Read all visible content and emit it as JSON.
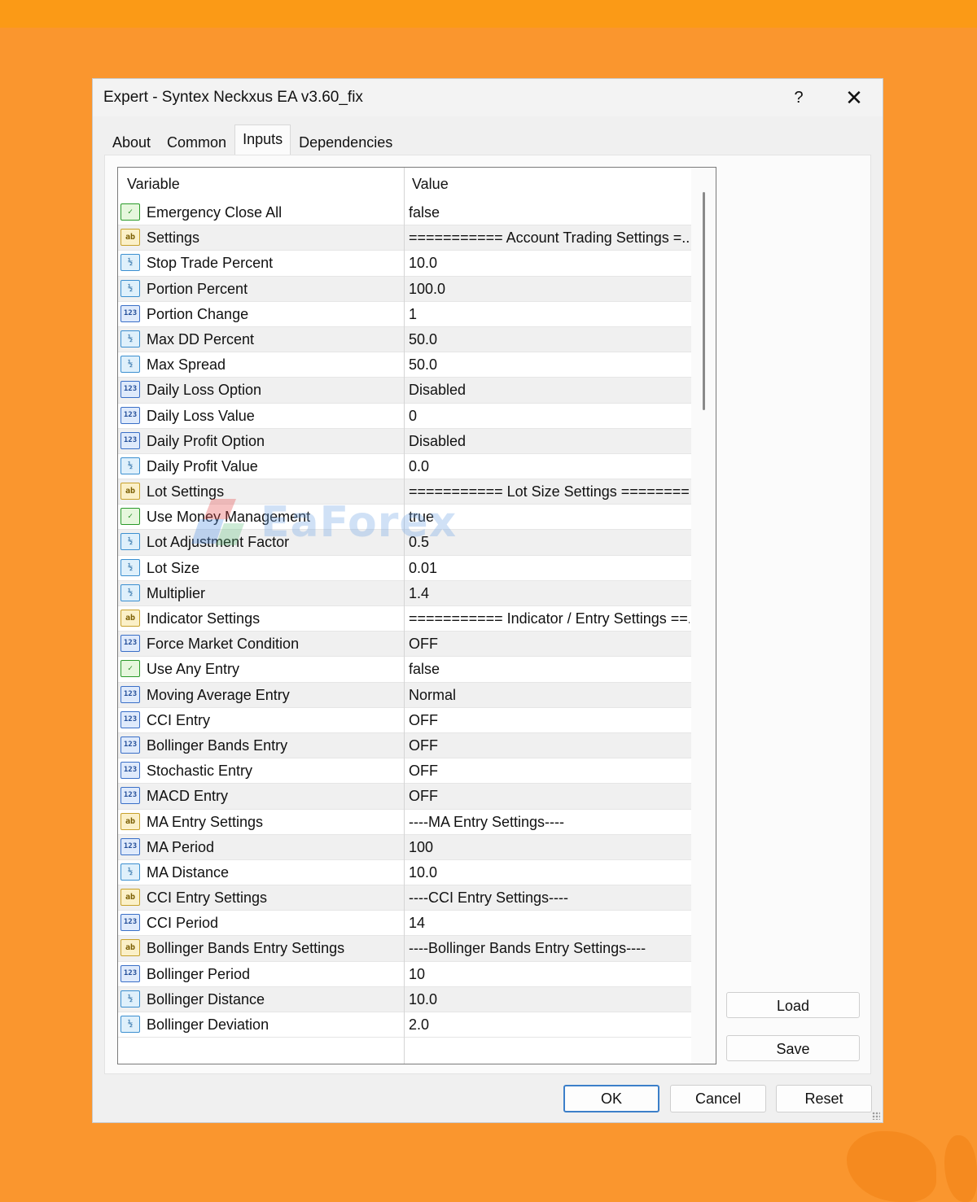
{
  "window": {
    "title": "Expert - Syntex Neckxus EA v3.60_fix",
    "help_glyph": "?",
    "close_glyph": "✕"
  },
  "tabs": [
    {
      "label": "About",
      "active": false
    },
    {
      "label": "Common",
      "active": false
    },
    {
      "label": "Inputs",
      "active": true
    },
    {
      "label": "Dependencies",
      "active": false
    }
  ],
  "grid": {
    "header": {
      "variable": "Variable",
      "value": "Value"
    },
    "rows": [
      {
        "type": "bool",
        "icon": "boolean-icon",
        "name": "Emergency Close All",
        "value": "false"
      },
      {
        "type": "str",
        "icon": "string-icon",
        "name": "Settings",
        "value": "=========== Account Trading Settings =..."
      },
      {
        "type": "dbl",
        "icon": "double-icon",
        "name": "Stop Trade Percent",
        "value": "10.0"
      },
      {
        "type": "dbl",
        "icon": "double-icon",
        "name": "Portion Percent",
        "value": "100.0"
      },
      {
        "type": "int",
        "icon": "integer-icon",
        "name": "Portion Change",
        "value": "1"
      },
      {
        "type": "dbl",
        "icon": "double-icon",
        "name": "Max DD Percent",
        "value": "50.0"
      },
      {
        "type": "dbl",
        "icon": "double-icon",
        "name": "Max Spread",
        "value": "50.0"
      },
      {
        "type": "int",
        "icon": "integer-icon",
        "name": "Daily Loss Option",
        "value": "Disabled"
      },
      {
        "type": "int",
        "icon": "integer-icon",
        "name": "Daily Loss Value",
        "value": "0"
      },
      {
        "type": "int",
        "icon": "integer-icon",
        "name": "Daily Profit Option",
        "value": "Disabled"
      },
      {
        "type": "dbl",
        "icon": "double-icon",
        "name": "Daily Profit Value",
        "value": "0.0"
      },
      {
        "type": "str",
        "icon": "string-icon",
        "name": "Lot Settings",
        "value": "=========== Lot Size Settings ========..."
      },
      {
        "type": "bool",
        "icon": "boolean-icon",
        "name": "Use Money Management",
        "value": "true"
      },
      {
        "type": "dbl",
        "icon": "double-icon",
        "name": "Lot Adjustment Factor",
        "value": "0.5"
      },
      {
        "type": "dbl",
        "icon": "double-icon",
        "name": "Lot Size",
        "value": "0.01"
      },
      {
        "type": "dbl",
        "icon": "double-icon",
        "name": "Multiplier",
        "value": "1.4"
      },
      {
        "type": "str",
        "icon": "string-icon",
        "name": "Indicator Settings",
        "value": "=========== Indicator / Entry Settings ==..."
      },
      {
        "type": "int",
        "icon": "integer-icon",
        "name": "Force Market Condition",
        "value": "OFF"
      },
      {
        "type": "bool",
        "icon": "boolean-icon",
        "name": "Use Any Entry",
        "value": "false"
      },
      {
        "type": "int",
        "icon": "integer-icon",
        "name": "Moving Average Entry",
        "value": "Normal"
      },
      {
        "type": "int",
        "icon": "integer-icon",
        "name": "CCI Entry",
        "value": "OFF"
      },
      {
        "type": "int",
        "icon": "integer-icon",
        "name": "Bollinger Bands Entry",
        "value": "OFF"
      },
      {
        "type": "int",
        "icon": "integer-icon",
        "name": "Stochastic Entry",
        "value": "OFF"
      },
      {
        "type": "int",
        "icon": "integer-icon",
        "name": "MACD Entry",
        "value": "OFF"
      },
      {
        "type": "str",
        "icon": "string-icon",
        "name": "MA Entry Settings",
        "value": "----MA Entry Settings----"
      },
      {
        "type": "int",
        "icon": "integer-icon",
        "name": "MA Period",
        "value": "100"
      },
      {
        "type": "dbl",
        "icon": "double-icon",
        "name": "MA Distance",
        "value": "10.0"
      },
      {
        "type": "str",
        "icon": "string-icon",
        "name": "CCI Entry Settings",
        "value": "----CCI Entry Settings----"
      },
      {
        "type": "int",
        "icon": "integer-icon",
        "name": "CCI Period",
        "value": "14"
      },
      {
        "type": "str",
        "icon": "string-icon",
        "name": "Bollinger Bands Entry Settings",
        "value": "----Bollinger Bands Entry Settings----"
      },
      {
        "type": "int",
        "icon": "integer-icon",
        "name": "Bollinger Period",
        "value": "10"
      },
      {
        "type": "dbl",
        "icon": "double-icon",
        "name": "Bollinger Distance",
        "value": "10.0"
      },
      {
        "type": "dbl",
        "icon": "double-icon",
        "name": "Bollinger Deviation",
        "value": "2.0"
      }
    ]
  },
  "icon_glyphs": {
    "bool": "✓",
    "str": "ab",
    "dbl": "½",
    "int": "123"
  },
  "buttons": {
    "load": "Load",
    "save": "Save",
    "ok": "OK",
    "cancel": "Cancel",
    "reset": "Reset"
  },
  "watermark": {
    "text": "EaForex"
  },
  "colors": {
    "background": "#fa962e",
    "accent_border": "#3c7fc9"
  }
}
